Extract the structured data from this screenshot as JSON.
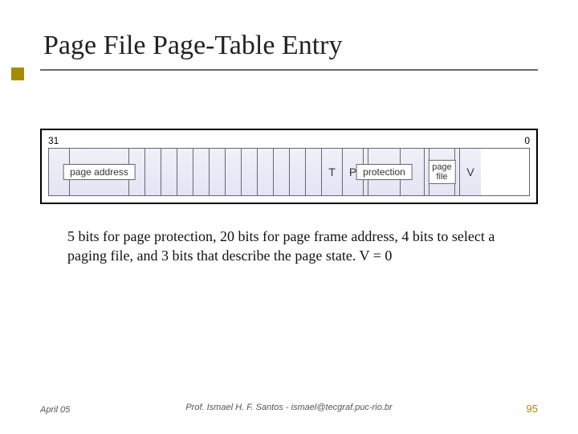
{
  "title": "Page File Page-Table Entry",
  "diagram": {
    "bit_high": "31",
    "bit_low": "0",
    "page_address_label": "page address",
    "t_label": "T",
    "p_label": "P",
    "protection_label": "protection",
    "page_file_label": "page\nfile",
    "v_label": "V"
  },
  "description": "5 bits for page protection, 20 bits for page frame address, 4 bits to select a paging file, and 3 bits that describe the page state.  V = 0",
  "footer": {
    "date": "April 05",
    "author": "Prof. Ismael H. F. Santos  -  ismael@tecgraf.puc-rio.br",
    "page": "95"
  }
}
